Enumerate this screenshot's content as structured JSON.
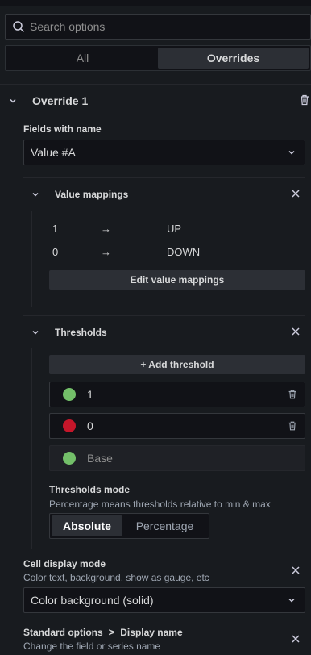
{
  "search": {
    "placeholder": "Search options",
    "value": ""
  },
  "tabs": [
    {
      "label": "All",
      "active": false
    },
    {
      "label": "Overrides",
      "active": true
    }
  ],
  "override": {
    "title": "Override 1",
    "matcher_label": "Fields with name",
    "matcher_value": "Value #A",
    "value_mappings": {
      "title": "Value mappings",
      "rows": [
        {
          "value": "1",
          "arrow": "→",
          "text": "UP"
        },
        {
          "value": "0",
          "arrow": "→",
          "text": "DOWN"
        }
      ],
      "edit_button": "Edit value mappings"
    },
    "thresholds": {
      "title": "Thresholds",
      "add_button": "+ Add threshold",
      "items": [
        {
          "value": "1",
          "color": "#73bf69"
        },
        {
          "value": "0",
          "color": "#c4162a"
        },
        {
          "value": "Base",
          "color": "#73bf69"
        }
      ],
      "mode_label": "Thresholds mode",
      "mode_desc": "Percentage means thresholds relative to min & max",
      "modes": [
        {
          "label": "Absolute",
          "active": true
        },
        {
          "label": "Percentage",
          "active": false
        }
      ]
    },
    "cell_display": {
      "label": "Cell display mode",
      "desc": "Color text, background, show as gauge, etc",
      "value": "Color background (solid)"
    },
    "standard_options": {
      "breadcrumb_parent": "Standard options",
      "breadcrumb_sep": ">",
      "breadcrumb_child": "Display name",
      "desc": "Change the field or series name"
    }
  },
  "colors": {
    "accent_green": "#73bf69",
    "accent_red": "#c4162a",
    "background": "#181b1f"
  }
}
